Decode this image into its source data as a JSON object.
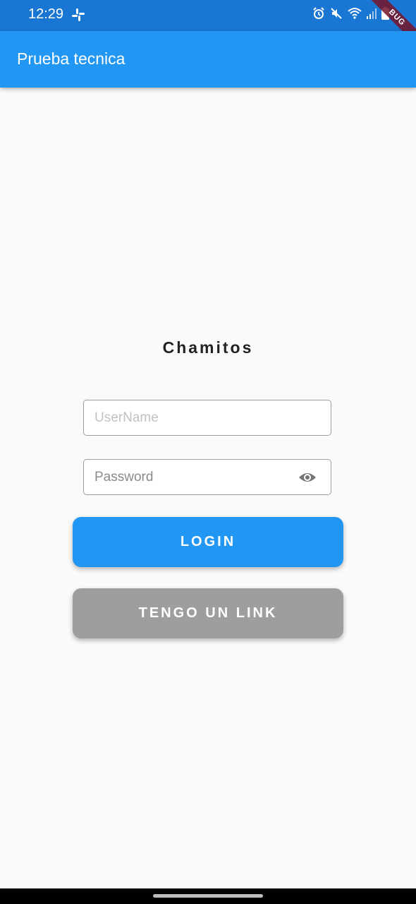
{
  "status_bar": {
    "time": "12:29",
    "icons": [
      "slack-icon",
      "alarm-icon",
      "mute-icon",
      "wifi-icon",
      "signal-icon",
      "battery-icon"
    ]
  },
  "debug_banner": {
    "label": "BUG"
  },
  "app_bar": {
    "title": "Prueba tecnica",
    "color": "#2196f3"
  },
  "main": {
    "title": "Chamitos",
    "username": {
      "value": "",
      "placeholder": "UserName"
    },
    "password": {
      "value": "",
      "placeholder": "Password",
      "toggle_icon": "eye-icon"
    },
    "login_button": {
      "label": "LOGIN",
      "color": "#2196f3"
    },
    "link_button": {
      "label": "TENGO UN LINK",
      "color": "#9e9e9e"
    }
  }
}
